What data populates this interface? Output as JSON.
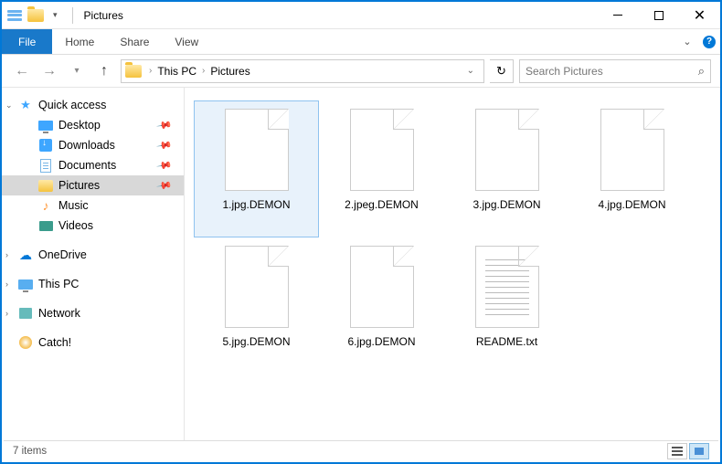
{
  "window": {
    "title": "Pictures"
  },
  "ribbon": {
    "file": "File",
    "tabs": [
      "Home",
      "Share",
      "View"
    ]
  },
  "breadcrumb": {
    "root": "This PC",
    "current": "Pictures"
  },
  "search": {
    "placeholder": "Search Pictures"
  },
  "sidebar": {
    "quick_access": "Quick access",
    "items": [
      {
        "label": "Desktop",
        "pinned": true
      },
      {
        "label": "Downloads",
        "pinned": true
      },
      {
        "label": "Documents",
        "pinned": true
      },
      {
        "label": "Pictures",
        "pinned": true,
        "selected": true
      },
      {
        "label": "Music",
        "pinned": false
      },
      {
        "label": "Videos",
        "pinned": false
      }
    ],
    "onedrive": "OneDrive",
    "thispc": "This PC",
    "network": "Network",
    "catch": "Catch!"
  },
  "files": [
    {
      "name": "1.jpg.DEMON",
      "type": "blank",
      "selected": true
    },
    {
      "name": "2.jpeg.DEMON",
      "type": "blank"
    },
    {
      "name": "3.jpg.DEMON",
      "type": "blank"
    },
    {
      "name": "4.jpg.DEMON",
      "type": "blank"
    },
    {
      "name": "5.jpg.DEMON",
      "type": "blank"
    },
    {
      "name": "6.jpg.DEMON",
      "type": "blank"
    },
    {
      "name": "README.txt",
      "type": "txt"
    }
  ],
  "status": {
    "count": "7 items"
  }
}
